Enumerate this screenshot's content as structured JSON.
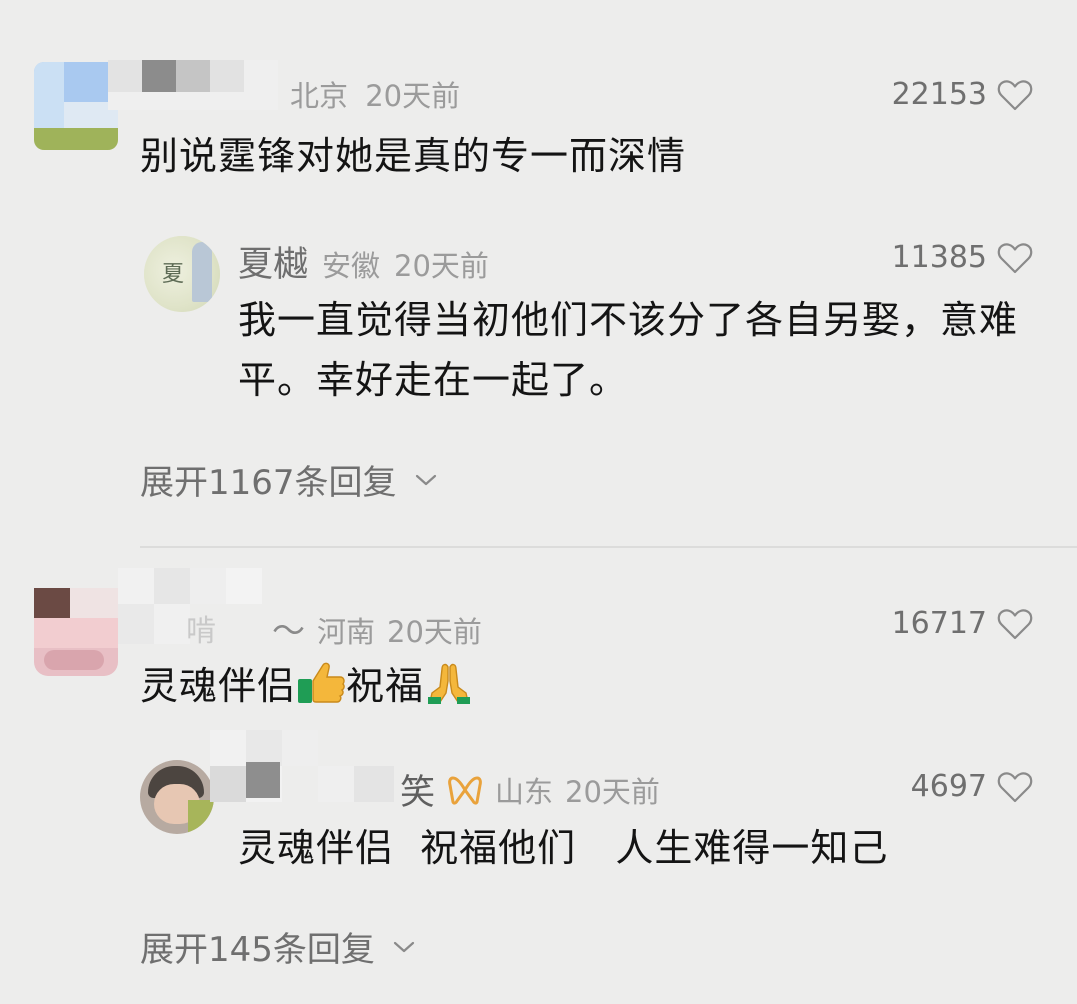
{
  "comments": [
    {
      "location": "北京",
      "time": "20天前",
      "likes": "22153",
      "text": "别说霆锋对她是真的专一而深情",
      "reply": {
        "username": "夏樾",
        "avatar_text": "夏",
        "location": "安徽",
        "time": "20天前",
        "likes": "11385",
        "text_line1": "我一直觉得当初他们不该分了各自另娶，意难",
        "text_line2": "平。幸好走在一起了。"
      },
      "expand_label": "展开1167条回复"
    },
    {
      "name_partial": "啃",
      "name_suffix": "～",
      "location": "河南",
      "time": "20天前",
      "likes": "16717",
      "text_part1": "灵魂伴侣",
      "text_part2": "祝福",
      "reply": {
        "name_partial": "笑",
        "location": "山东",
        "time": "20天前",
        "likes": "4697",
        "text": "灵魂伴侣  祝福他们   人生难得一知己"
      },
      "expand_label": "展开145条回复"
    }
  ],
  "icons": {
    "like": "heart-outline-icon",
    "expand": "chevron-down-icon",
    "thumbs_up": "thumbs-up-emoji",
    "pray": "folded-hands-emoji",
    "badge": "ribbon-badge-icon"
  },
  "colors": {
    "background": "#ededec",
    "meta": "#9b9b9b",
    "badge": "#e9a23b"
  }
}
